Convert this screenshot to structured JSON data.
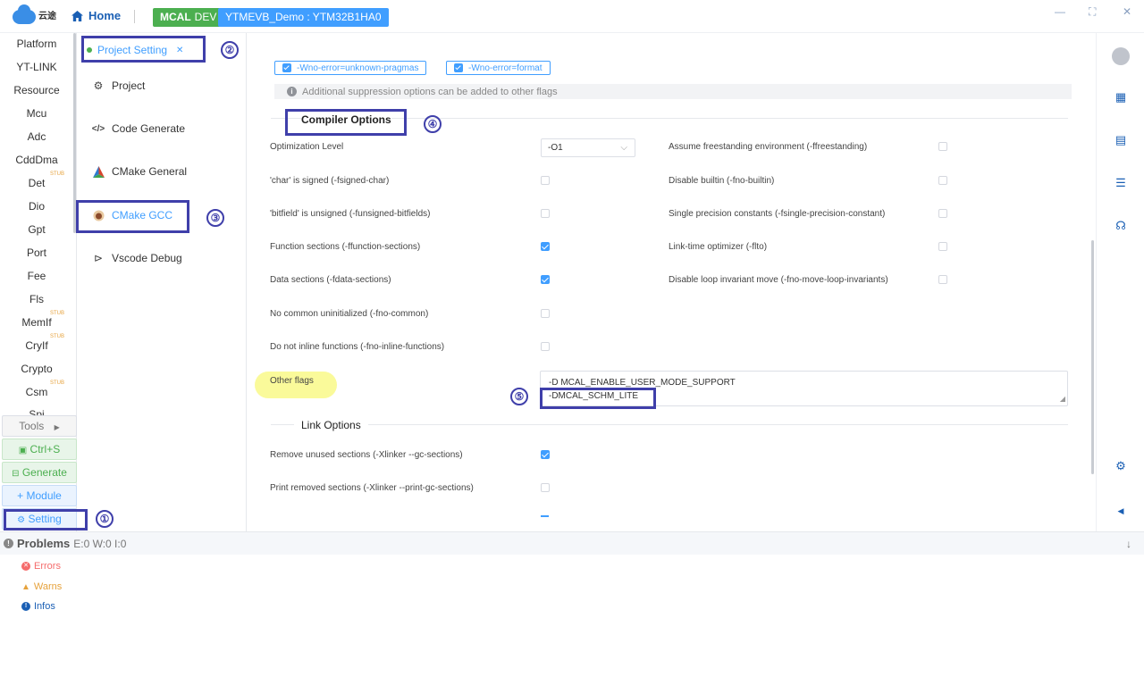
{
  "topbar": {
    "logo_text": "云途",
    "home_label": "Home",
    "badge_mcal_bold": "MCAL",
    "badge_mcal_rest": "DEV",
    "project_badge": "YTMEVB_Demo : YTM32B1HA0"
  },
  "sidebar": {
    "items": [
      {
        "label": "Platform"
      },
      {
        "label": "YT-LINK"
      },
      {
        "label": "Resource"
      },
      {
        "label": "Mcu"
      },
      {
        "label": "Adc"
      },
      {
        "label": "CddDma"
      },
      {
        "label": "Det",
        "stub": "STUB"
      },
      {
        "label": "Dio"
      },
      {
        "label": "Gpt"
      },
      {
        "label": "Port"
      },
      {
        "label": "Fee"
      },
      {
        "label": "Fls"
      },
      {
        "label": "MemIf",
        "stub": "STUB"
      },
      {
        "label": "CryIf",
        "stub": "STUB"
      },
      {
        "label": "Crypto"
      },
      {
        "label": "Csm",
        "stub": "STUB"
      },
      {
        "label": "Spi"
      }
    ],
    "tools_label": "Tools",
    "ctrls_label": "Ctrl+S",
    "generate_label": "Generate",
    "module_label": "Module",
    "setting_label": "Setting"
  },
  "midmenu": {
    "tab_label": "Project Setting",
    "items": [
      {
        "label": "Project",
        "icon": "gear-icon"
      },
      {
        "label": "Code Generate",
        "icon": "code-icon"
      },
      {
        "label": "CMake General",
        "icon": "cmake-icon"
      },
      {
        "label": "CMake GCC",
        "icon": "gcc-icon"
      },
      {
        "label": "Vscode Debug",
        "icon": "debug-icon"
      }
    ]
  },
  "content": {
    "suppress_tags": [
      "-Wno-error=unknown-pragmas",
      "-Wno-error=format"
    ],
    "info_text": "Additional suppression options can be added to other flags",
    "compiler_title": "Compiler Options",
    "opt_level_label": "Optimization Level",
    "opt_level_value": "-O1",
    "left_options": [
      {
        "label": "'char' is signed (-fsigned-char)",
        "checked": false
      },
      {
        "label": "'bitfield' is unsigned (-funsigned-bitfields)",
        "checked": false
      },
      {
        "label": "Function sections (-ffunction-sections)",
        "checked": true
      },
      {
        "label": "Data sections (-fdata-sections)",
        "checked": true
      },
      {
        "label": "No common uninitialized (-fno-common)",
        "checked": false
      },
      {
        "label": "Do not inline functions (-fno-inline-functions)",
        "checked": false
      }
    ],
    "right_options": [
      {
        "label": "Assume freestanding environment (-ffreestanding)",
        "checked": false
      },
      {
        "label": "Disable builtin (-fno-builtin)",
        "checked": false
      },
      {
        "label": "Single precision constants (-fsingle-precision-constant)",
        "checked": false
      },
      {
        "label": "Link-time optimizer (-flto)",
        "checked": false
      },
      {
        "label": "Disable loop invariant move (-fno-move-loop-invariants)",
        "checked": false
      }
    ],
    "other_flags_label": "Other flags",
    "other_flags_line1": "-D MCAL_ENABLE_USER_MODE_SUPPORT",
    "other_flags_line2": "-DMCAL_SCHM_LITE",
    "link_title": "Link Options",
    "link_options": [
      {
        "label": "Remove unused sections (-Xlinker --gc-sections)",
        "checked": true
      },
      {
        "label": "Print removed sections (-Xlinker --print-gc-sections)",
        "checked": false
      }
    ]
  },
  "problems": {
    "title": "Problems",
    "counts": "E:0 W:0 I:0",
    "errors_label": "Errors",
    "warns_label": "Warns",
    "infos_label": "Infos"
  },
  "annotations": {
    "n1": "①",
    "n2": "②",
    "n3": "③",
    "n4": "④",
    "n5": "⑤"
  },
  "colors": {
    "accent": "#409eff",
    "success": "#4caf50",
    "annotation": "#3f3faa",
    "error": "#f56c6c",
    "warn": "#e6a23c"
  }
}
